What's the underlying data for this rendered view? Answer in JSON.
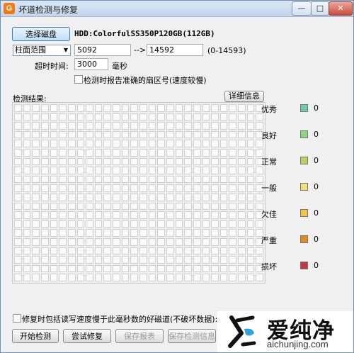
{
  "window": {
    "title": "坏道检测与修复",
    "app_icon": "G",
    "controls": {
      "minimize": "—",
      "maximize": "□",
      "close": "✕"
    }
  },
  "disk": {
    "select_button": "选择磁盘",
    "name": "HDD:ColorfulSS350P120GB(112GB)"
  },
  "range": {
    "mode": "柱面范围",
    "start": "5092",
    "arrow": "-->",
    "end": "14592",
    "hint": "(0-14593)"
  },
  "timeout": {
    "label": "超时时间:",
    "value": "3000",
    "unit": "毫秒"
  },
  "accurate_sector": {
    "label": "检测时报告准确的扇区号(速度较慢)",
    "checked": false
  },
  "results": {
    "label": "检测结果:",
    "details_button": "详细信息"
  },
  "legend": [
    {
      "label": "优秀",
      "color": "#6fcca7",
      "count": "0"
    },
    {
      "label": "良好",
      "color": "#8fd67c",
      "count": "0"
    },
    {
      "label": "正常",
      "color": "#b8d458",
      "count": "0"
    },
    {
      "label": "一般",
      "color": "#efe07c",
      "count": "0"
    },
    {
      "label": "欠佳",
      "color": "#f4c43a",
      "count": "0"
    },
    {
      "label": "严重",
      "color": "#e58a22",
      "count": "0"
    },
    {
      "label": "损坏",
      "color": "#c8343f",
      "count": "0"
    }
  ],
  "repair_option": {
    "label": "修复时包括读写速度慢于此毫秒数的好磁道(不破坏数据):",
    "checked": false
  },
  "actions": {
    "start": "开始检测",
    "repair": "尝试修复",
    "save_report": "保存报表",
    "save_info": "保存检测信息"
  },
  "watermark": {
    "brand": "爱纯净",
    "url": "aichunjing.com"
  }
}
